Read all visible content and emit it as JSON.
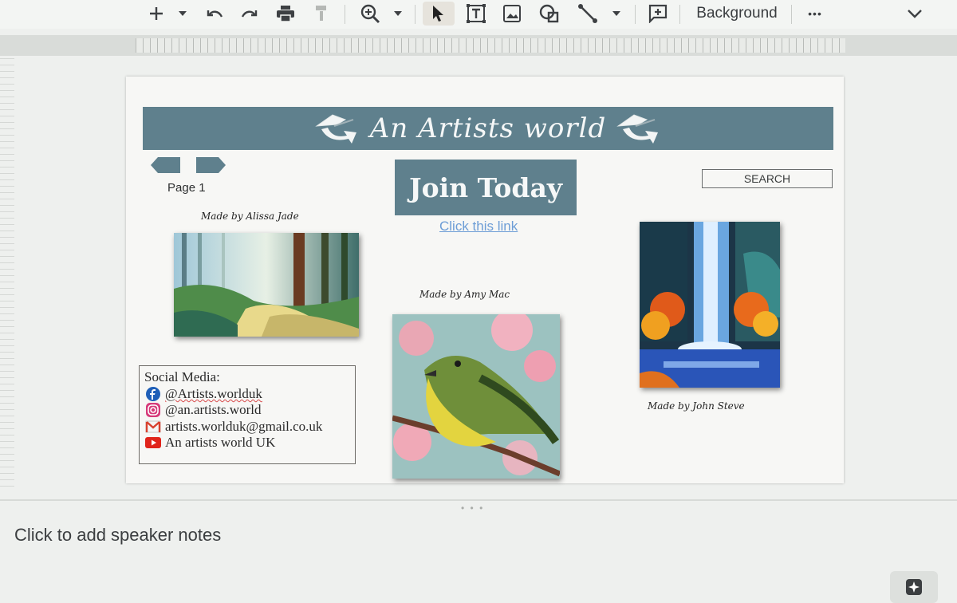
{
  "toolbar": {
    "icons": [
      "plus-icon",
      "dropdown-icon",
      "undo-icon",
      "redo-icon",
      "print-icon",
      "paint-format-icon",
      "zoom-icon",
      "dropdown-icon",
      "select-cursor-icon",
      "text-box-icon",
      "image-icon",
      "shape-icon",
      "line-icon",
      "dropdown-icon",
      "comment-icon",
      "more-icon",
      "collapse-icon"
    ],
    "background_label": "Background",
    "more_label": "•••"
  },
  "slide": {
    "banner_title": "An Artists world",
    "page_label": "Page 1",
    "join_button": "Join Today",
    "link_text": "Click this link",
    "search_label": "SEARCH",
    "artworks": [
      {
        "caption": "Made by Alissa Jade",
        "subject": "forest painting"
      },
      {
        "caption": "Made by Amy Mac",
        "subject": "bird painting"
      },
      {
        "caption": "Made by John Steve",
        "subject": "waterfall painting"
      }
    ],
    "social": {
      "heading": "Social Media:",
      "items": [
        {
          "icon": "facebook-icon",
          "text": "@Artists.worlduk"
        },
        {
          "icon": "instagram-icon",
          "text": "@an.artists.world"
        },
        {
          "icon": "gmail-icon",
          "text": "artists.worlduk@gmail.co.uk"
        },
        {
          "icon": "youtube-icon",
          "text": "An artists world UK"
        }
      ]
    }
  },
  "notes": {
    "placeholder": "Click to add speaker notes",
    "resize_dots": "• • •"
  },
  "colors": {
    "banner": "#5f808d",
    "link": "#6d9dd6",
    "toolbar_bg": "#f3f5f3"
  }
}
